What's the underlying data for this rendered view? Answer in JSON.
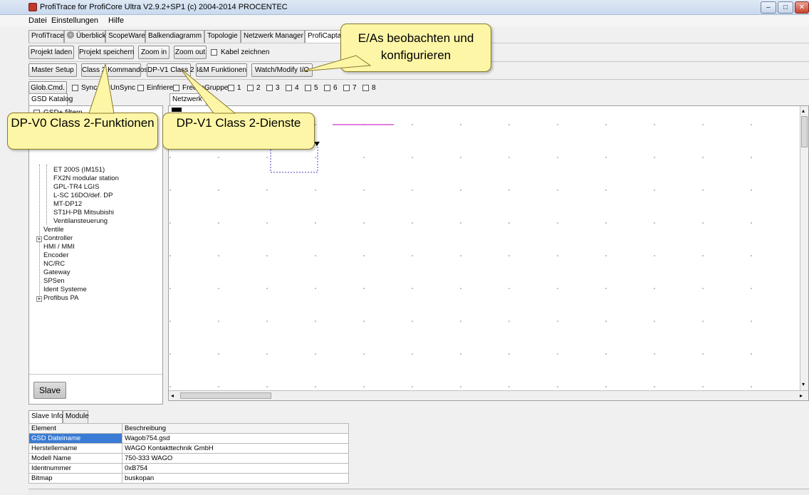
{
  "window": {
    "title": "ProfiTrace for ProfiCore Ultra V2.9.2+SP1 (c) 2004-2014 PROCENTEC",
    "minimize": "–",
    "restore": "□",
    "close": "✕"
  },
  "menu": [
    "Datei",
    "Einstellungen",
    "Hilfe"
  ],
  "tabs": [
    "ProfiTrace",
    "Überblick",
    "ScopeWare",
    "Balkendiagramm",
    "Topologie",
    "Netzwerk Manager",
    "ProfiCaptain"
  ],
  "toolbar1": {
    "load": "Projekt laden",
    "save": "Projekt speichern",
    "zoom_in": "Zoom in",
    "zoom_out": "Zoom out",
    "draw_cable": "Kabel zeichnen"
  },
  "toolbar2": {
    "master_setup": "Master Setup",
    "class2_commands": "Class 2 Kommandos",
    "dpv1_class2": "DP-V1 Class 2",
    "im_functions": "I&M Funktionen",
    "watch_modify": "Watch/Modify I/O"
  },
  "toolbar3": {
    "glob_cmd": "Glob.Cmd.",
    "sync": "Sync",
    "unsync": "UnSync",
    "einfrieren": "Einfrieren",
    "freeze": "Freeze",
    "gruppe": "Gruppe",
    "groups": [
      "1",
      "2",
      "3",
      "4",
      "5",
      "6",
      "7",
      "8"
    ]
  },
  "left_panel": {
    "tab": "GSD Katalog",
    "gsd_filter": "GSD+ filtern",
    "tree": [
      "ET 200S (IM151)",
      "FX2N modular station",
      "GPL-TR4 LGIS",
      "L-SC 16DO/def. DP",
      "MT-DP12",
      "ST1H-PB Mitsubishi",
      "Ventilansteuerung",
      "Ventile",
      "Controller",
      "HMI / MMI",
      "Encoder",
      "NC/RC",
      "Gateway",
      "SPSen",
      "Ident Systeme",
      "Profibus PA"
    ],
    "slave_button": "Slave"
  },
  "canvas": {
    "tab": "Netzwerk"
  },
  "callouts": {
    "eas": "E/As beobachten und konfigurieren",
    "dpv0": "DP-V0 Class 2-Funktionen",
    "dpv1": "DP-V1 Class 2-Dienste"
  },
  "bottom": {
    "tabs": [
      "Slave Info",
      "Module"
    ],
    "headers": [
      "Element",
      "Beschreibung"
    ],
    "rows": [
      [
        "GSD Dateiname",
        "Wagob754.gsd"
      ],
      [
        "Herstellername",
        "WAGO Kontakttechnik GmbH"
      ],
      [
        "Modell Name",
        "750-333 WAGO"
      ],
      [
        "Identnummer",
        "0xB754"
      ],
      [
        "Bitmap",
        "buskopan"
      ]
    ]
  },
  "colors": {
    "callout": "#fdf6a6",
    "selection": "#3a7bd5",
    "magenta_line": "#c000c0"
  }
}
